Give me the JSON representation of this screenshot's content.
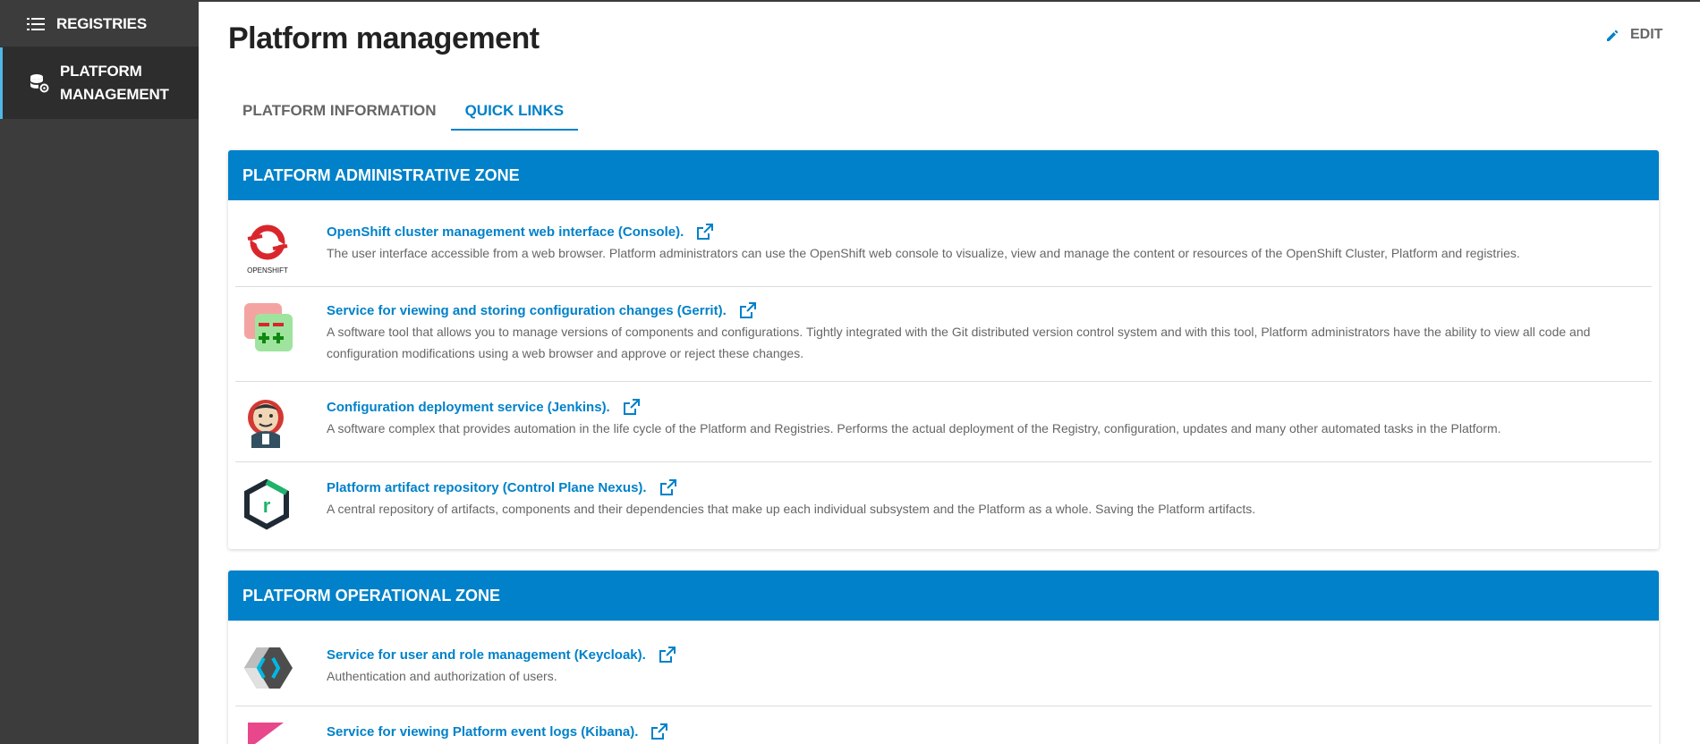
{
  "sidebar": {
    "items": [
      {
        "label": "REGISTRIES",
        "icon": "list-icon"
      },
      {
        "label": "PLATFORM MANAGEMENT",
        "icon": "database-gear-icon"
      }
    ]
  },
  "header": {
    "title": "Platform management",
    "edit_label": "EDIT"
  },
  "tabs": [
    {
      "label": "PLATFORM INFORMATION",
      "active": false
    },
    {
      "label": "QUICK LINKS",
      "active": true
    }
  ],
  "zones": [
    {
      "title": "PLATFORM ADMINISTRATIVE ZONE",
      "links": [
        {
          "title": "OpenShift cluster management web interface (Console).",
          "description": "The user interface accessible from a web browser. Platform administrators can use the OpenShift web console to visualize, view and manage the content or resources of the OpenShift Cluster, Platform and registries.",
          "logo": "openshift-logo",
          "logo_text": "OPENSHIFT"
        },
        {
          "title": "Service for viewing and storing configuration changes (Gerrit).",
          "description": "A software tool that allows you to manage versions of components and configurations. Tightly integrated with the Git distributed version control system and with this tool, Platform administrators have the ability to view all code and configuration modifications using a web browser and approve or reject these changes.",
          "logo": "gerrit-logo"
        },
        {
          "title": "Configuration deployment service (Jenkins).",
          "description": "A software complex that provides automation in the life cycle of the Platform and Registries. Performs the actual deployment of the Registry, configuration, updates and many other automated tasks in the Platform.",
          "logo": "jenkins-logo"
        },
        {
          "title": "Platform artifact repository (Control Plane Nexus).",
          "description": "A central repository of artifacts, components and their dependencies that make up each individual subsystem and the Platform as a whole. Saving the Platform artifacts.",
          "logo": "nexus-logo"
        }
      ]
    },
    {
      "title": "PLATFORM OPERATIONAL ZONE",
      "links": [
        {
          "title": "Service for user and role management (Keycloak).",
          "description": "Authentication and authorization of users.",
          "logo": "keycloak-logo"
        },
        {
          "title": "Service for viewing Platform event logs (Kibana).",
          "description": "",
          "logo": "kibana-logo"
        }
      ]
    }
  ],
  "colors": {
    "accent": "#0081c9",
    "sidebar_bg": "#3c3c3c",
    "sidebar_active_bg": "#2d2d2d",
    "sidebar_active_border": "#4fb8e8"
  }
}
